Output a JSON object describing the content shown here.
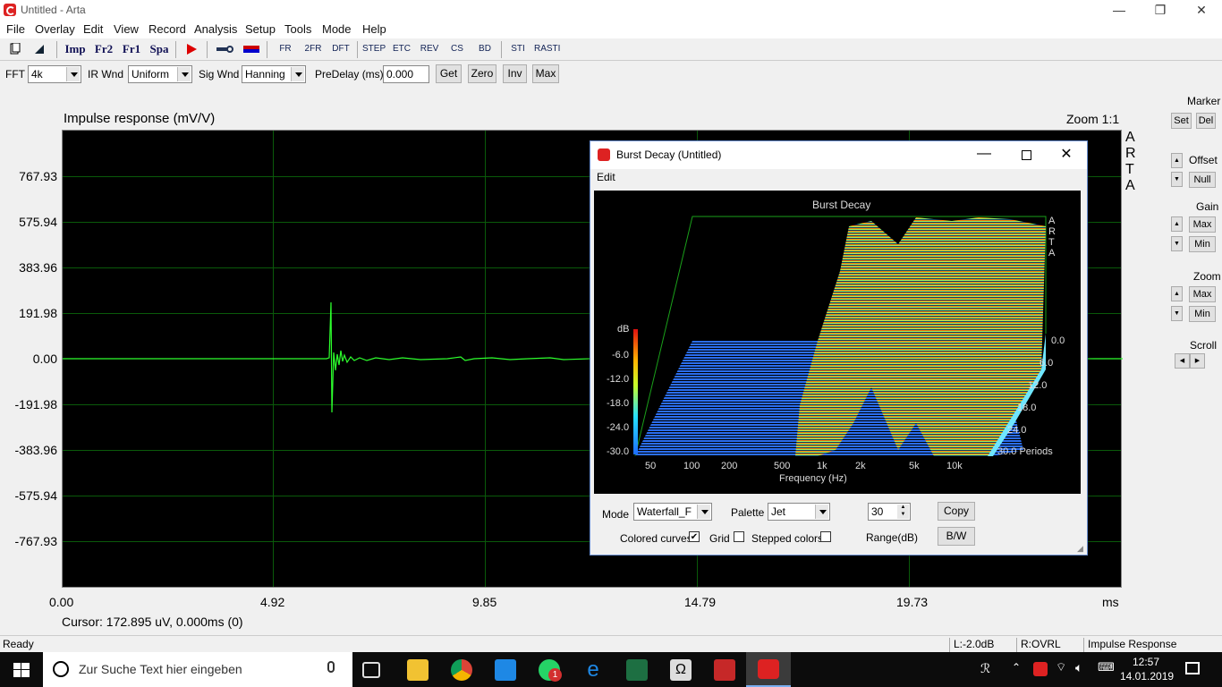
{
  "window": {
    "title": "Untitled - Arta",
    "min": "—",
    "max": "❐",
    "close": "✕"
  },
  "menu": [
    "File",
    "Overlay",
    "Edit",
    "View",
    "Record",
    "Analysis",
    "Setup",
    "Tools",
    "Mode",
    "Help"
  ],
  "toolbar1": {
    "imp": "Imp",
    "fr2": "Fr2",
    "fr1": "Fr1",
    "spa": "Spa",
    "fr_icon": "FR",
    "twofr_icon": "2FR",
    "dft_icon": "DFT",
    "step_icon": "STEP",
    "etc_icon": "ETC",
    "rev_icon": "REV",
    "cs_icon": "CS",
    "bd_icon": "BD",
    "sti_icon": "STI",
    "rasti_icon": "RASTI"
  },
  "toolbar2": {
    "fft_label": "FFT",
    "fft_value": "4k",
    "irwnd_label": "IR Wnd",
    "irwnd_value": "Uniform",
    "sigwnd_label": "Sig Wnd",
    "sigwnd_value": "Hanning",
    "predelay_label": "PreDelay (ms)",
    "predelay_value": "0.000",
    "get": "Get",
    "zero": "Zero",
    "inv": "Inv",
    "max": "Max"
  },
  "plot": {
    "title": "Impulse response (mV/V)",
    "zoom": "Zoom 1:1",
    "brand": "A R T A",
    "yticks": [
      "767.93",
      "575.94",
      "383.96",
      "191.98",
      "0.00",
      "-191.98",
      "-383.96",
      "-575.94",
      "-767.93"
    ],
    "xticks": [
      "0.00",
      "4.92",
      "9.85",
      "14.79",
      "19.73"
    ],
    "xunit": "ms",
    "cursor": "Cursor: 172.895 uV, 0.000ms (0)",
    "trace_color": "#2dff2d"
  },
  "side": {
    "marker": "Marker",
    "set": "Set",
    "del": "Del",
    "offset": "Offset",
    "null": "Null",
    "gain": "Gain",
    "gmax": "Max",
    "gmin": "Min",
    "zoom": "Zoom",
    "zmax": "Max",
    "zmin": "Min",
    "scroll": "Scroll"
  },
  "status": {
    "ready": "Ready",
    "l": "L:-2.0dB",
    "r": "R:OVRL",
    "mode": "Impulse Response"
  },
  "dialog": {
    "title": "Burst Decay  (Untitled)",
    "menu": "Edit",
    "chart_title": "Burst Decay",
    "db_label": "dB",
    "db_ticks": [
      "-6.0",
      "-12.0",
      "-18.0",
      "-24.0",
      "-30.0"
    ],
    "freq_ticks": [
      "50",
      "100",
      "200",
      "500",
      "1k",
      "2k",
      "5k",
      "10k"
    ],
    "xlabel": "Frequency (Hz)",
    "periods": [
      "0.0",
      "6.0",
      "12.0",
      "18.0",
      "24.0",
      "30.0 Periods"
    ],
    "brand": "A R T A",
    "mode_label": "Mode",
    "mode_value": "Waterfall_F",
    "palette_label": "Palette",
    "palette_value": "Jet",
    "range_value": "30",
    "range_label": "Range(dB)",
    "copy": "Copy",
    "bw": "B/W",
    "colored_curves": "Colored curves",
    "colored_checked": "✔",
    "grid": "Grid",
    "stepped": "Stepped colors"
  },
  "taskbar": {
    "search": "Zur Suche Text hier eingeben",
    "time": "12:57",
    "date": "14.01.2019",
    "badge": "1"
  }
}
